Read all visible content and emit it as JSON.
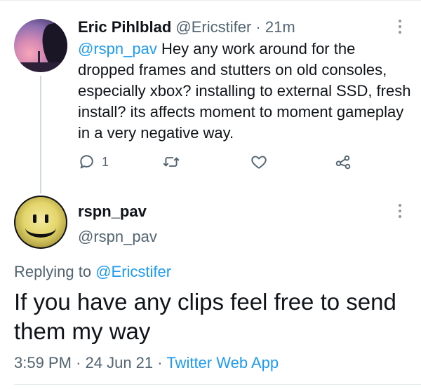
{
  "tweet": {
    "author_name": "Eric Pihlblad",
    "author_handle": "@Ericstifer",
    "separator": "·",
    "time_ago": "21m",
    "mention": "@rspn_pav",
    "text": " Hey any work around for the dropped frames and stutters on old consoles, especially xbox? installing to external SSD, fresh install? its affects moment to moment gameplay in a very negative way.",
    "reply_count": "1",
    "icons": [
      "reply-icon",
      "retweet-icon",
      "like-icon",
      "share-icon",
      "more-icon"
    ]
  },
  "reply": {
    "author_name": "rspn_pav",
    "author_handle": "@rspn_pav",
    "replying_prefix": "Replying to ",
    "replying_to": "@Ericstifer",
    "text": "If you have any clips feel free to send them my way",
    "time": "3:59 PM",
    "separator": "·",
    "date": "24 Jun 21",
    "source": "Twitter Web App"
  },
  "colors": {
    "accent": "#1d9bf0",
    "secondary_text": "#536471",
    "primary_text": "#0f1419"
  }
}
